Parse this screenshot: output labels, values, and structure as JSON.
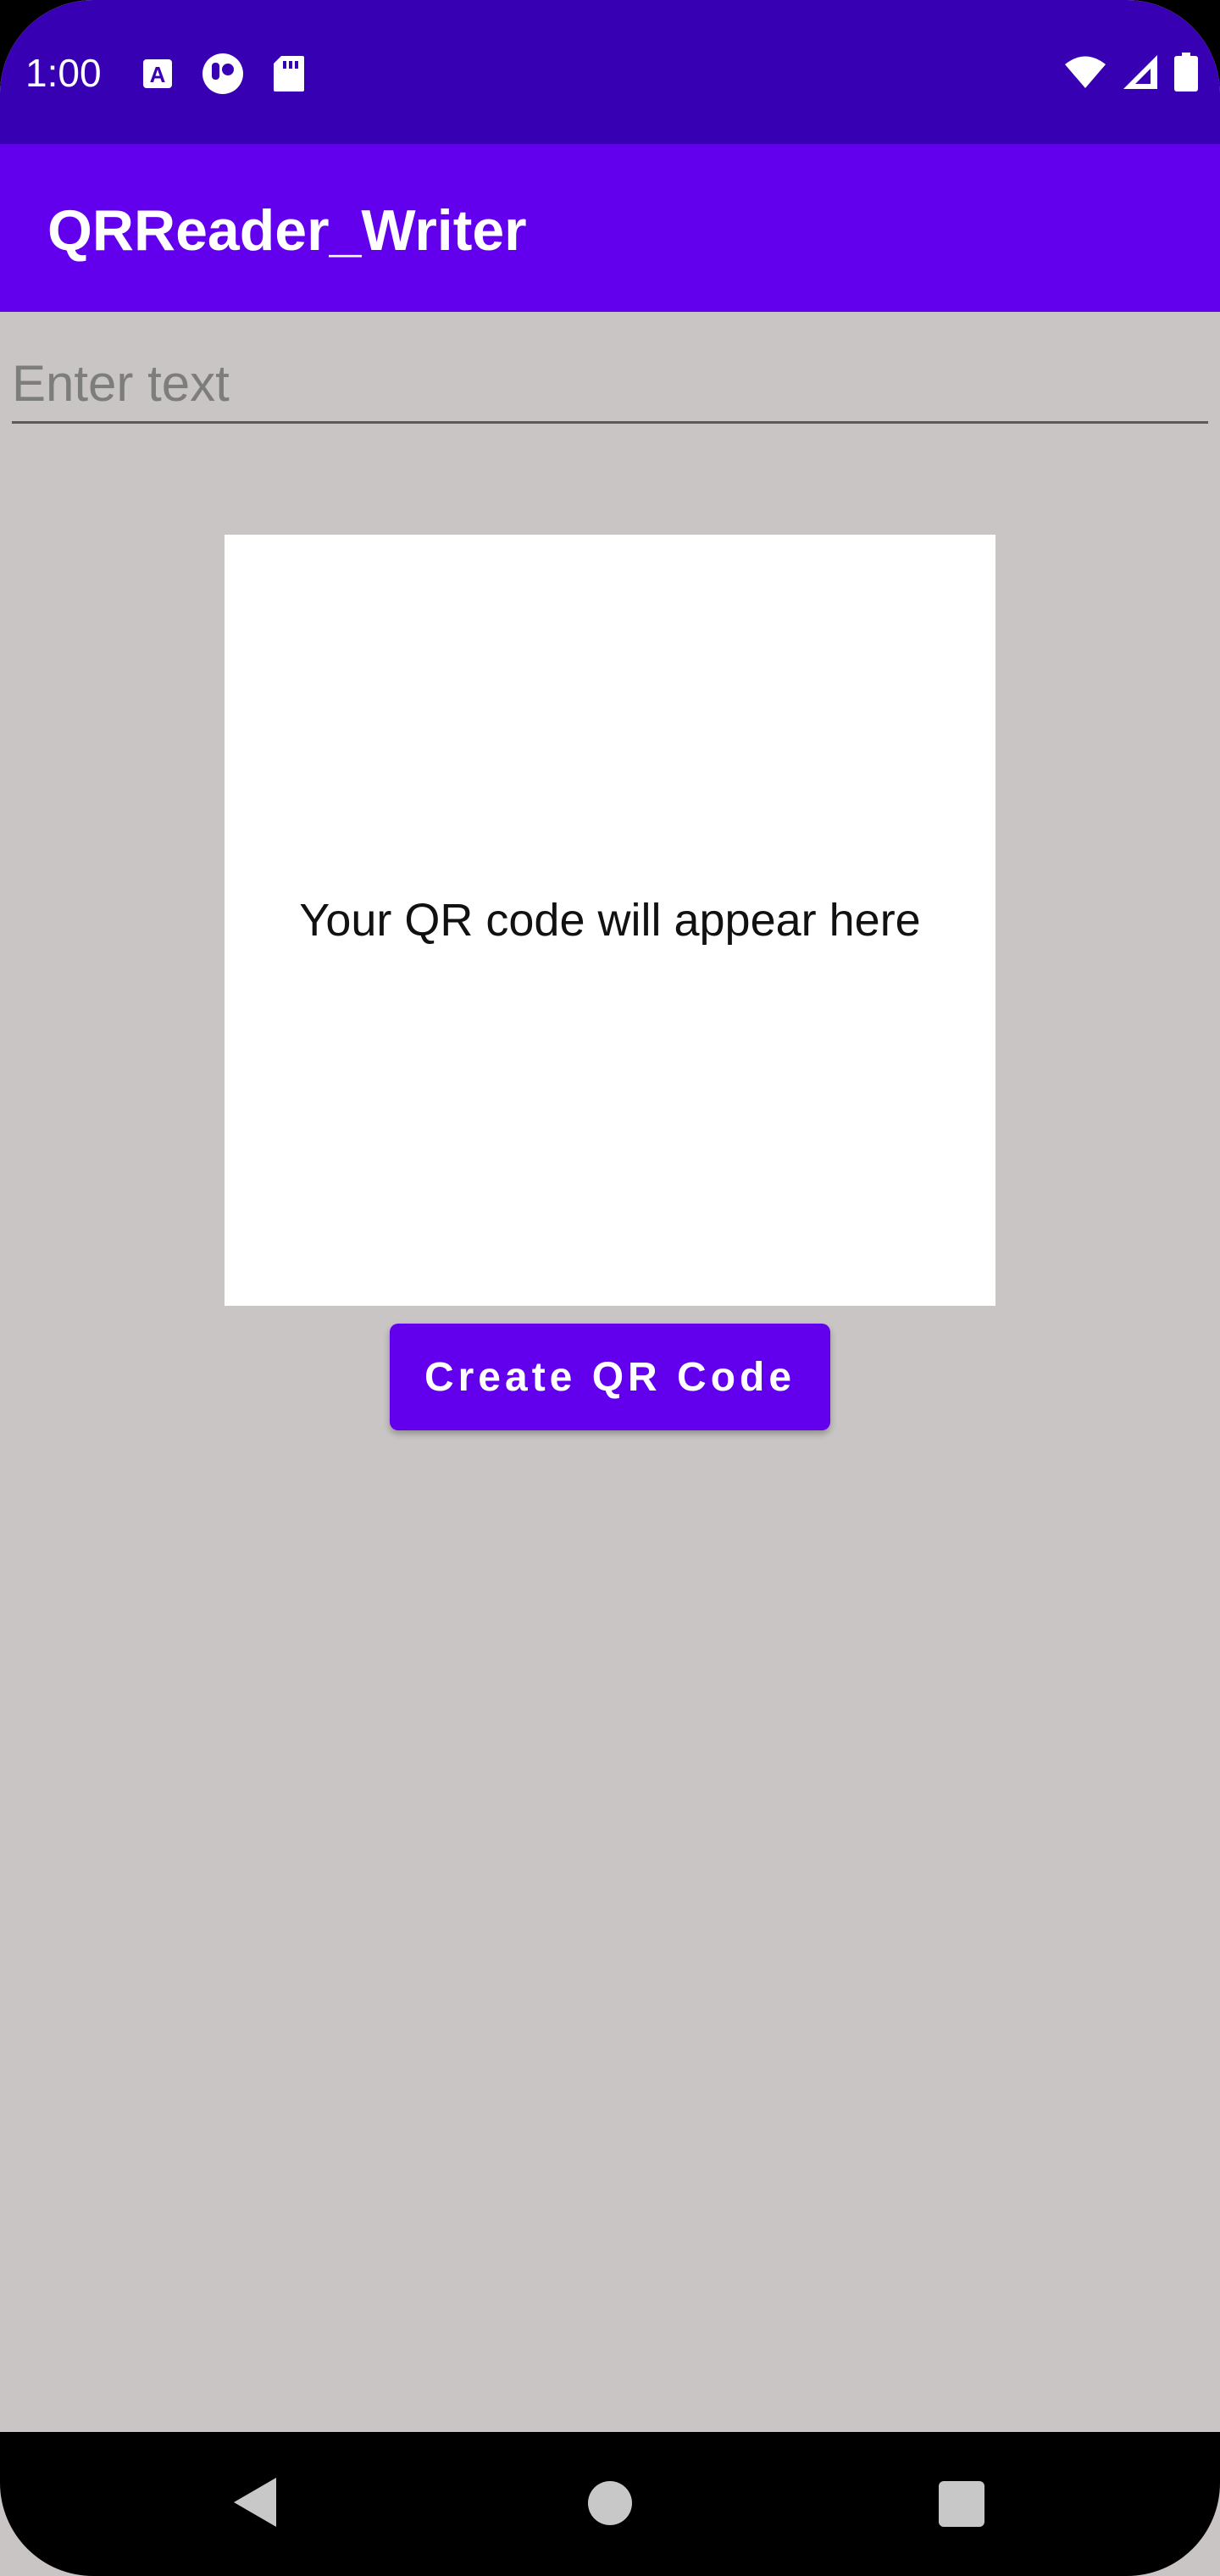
{
  "status_bar": {
    "time": "1:00",
    "left_icons": [
      "text-a-icon",
      "app-notification-icon",
      "sd-card-icon"
    ],
    "right_icons": [
      "wifi-icon",
      "cell-signal-icon",
      "battery-icon"
    ]
  },
  "app_bar": {
    "title": "QRReader_Writer"
  },
  "main": {
    "text_input": {
      "placeholder": "Enter text",
      "value": ""
    },
    "qr_placeholder": "Your QR code will appear here",
    "create_button_label": "Create QR Code"
  },
  "nav_bar": {
    "icons": [
      "back-icon",
      "home-icon",
      "recents-icon"
    ]
  },
  "colors": {
    "status_bar": "#3700B3",
    "app_bar": "#6200EE",
    "background": "#C9C5C5",
    "button": "#6200EE"
  }
}
